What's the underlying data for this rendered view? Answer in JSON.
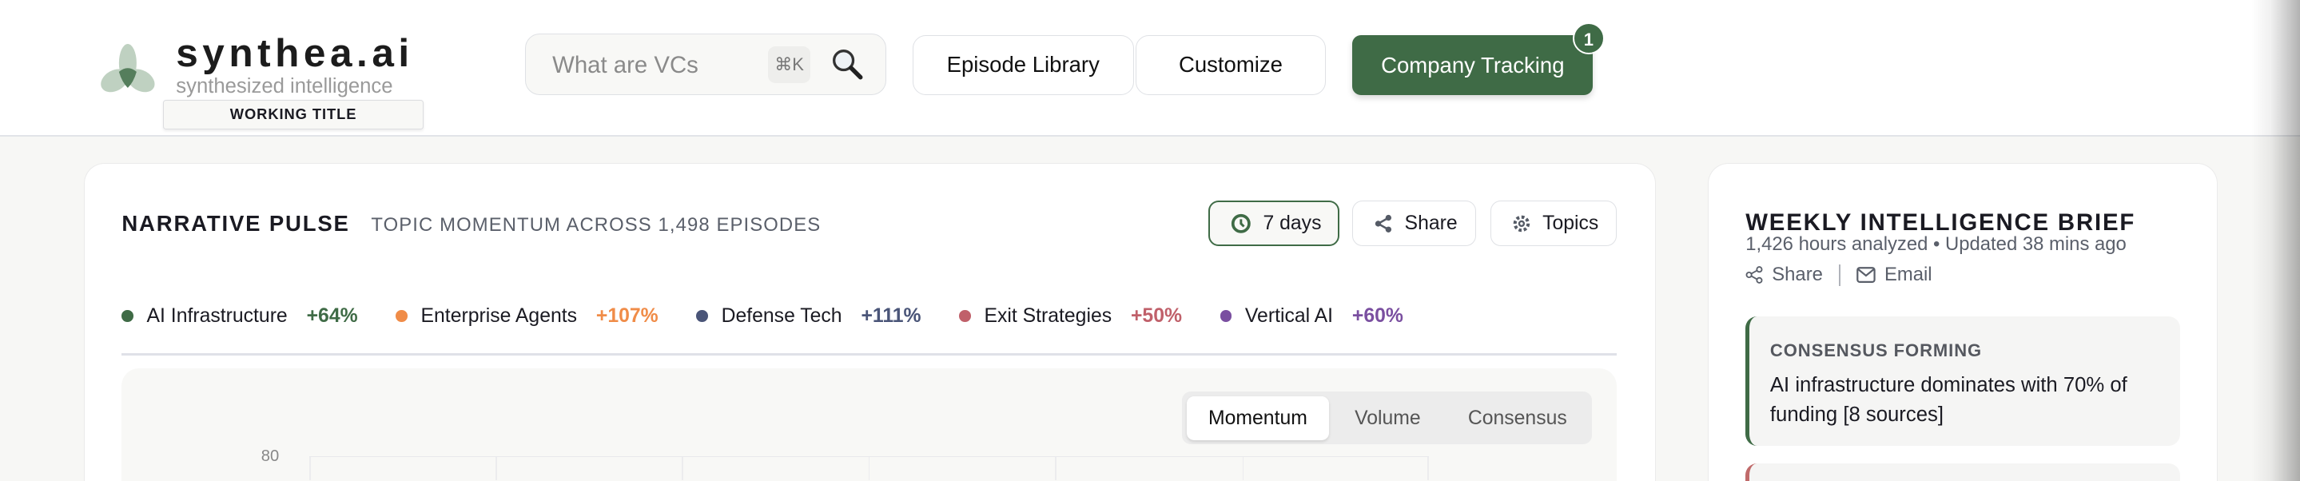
{
  "brand": {
    "name": "synthea.ai",
    "tagline": "synthesized intelligence",
    "badge": "WORKING TITLE"
  },
  "search": {
    "placeholder": "What are VCs",
    "shortcut": "⌘K",
    "icon": "magnifier-icon"
  },
  "nav": {
    "episode_library": "Episode Library",
    "customize": "Customize",
    "company_tracking": "Company Tracking",
    "company_tracking_count": "1"
  },
  "colors": {
    "accent": "#3f6b46"
  },
  "pulse": {
    "title": "NARRATIVE PULSE",
    "subtitle": "TOPIC MOMENTUM ACROSS 1,498 EPISODES",
    "range_button": "7 days",
    "share_button": "Share",
    "topics_button": "Topics",
    "legend": [
      {
        "label": "AI Infrastructure",
        "change": "+64%",
        "color": "#3f6b46"
      },
      {
        "label": "Enterprise Agents",
        "change": "+107%",
        "color": "#f08c48"
      },
      {
        "label": "Defense Tech",
        "change": "+111%",
        "color": "#4a5578"
      },
      {
        "label": "Exit Strategies",
        "change": "+50%",
        "color": "#c0606a"
      },
      {
        "label": "Vertical AI",
        "change": "+60%",
        "color": "#7a4fa0"
      }
    ],
    "tabs": [
      "Momentum",
      "Volume",
      "Consensus"
    ],
    "active_tab": "Momentum",
    "y_tick": "80"
  },
  "brief": {
    "title": "WEEKLY INTELLIGENCE BRIEF",
    "meta": "1,426 hours analyzed • Updated 38 mins ago",
    "share": "Share",
    "email": "Email",
    "items": [
      {
        "label": "CONSENSUS FORMING",
        "text": "AI infrastructure dominates with 70% of funding [8 sources]"
      }
    ]
  }
}
